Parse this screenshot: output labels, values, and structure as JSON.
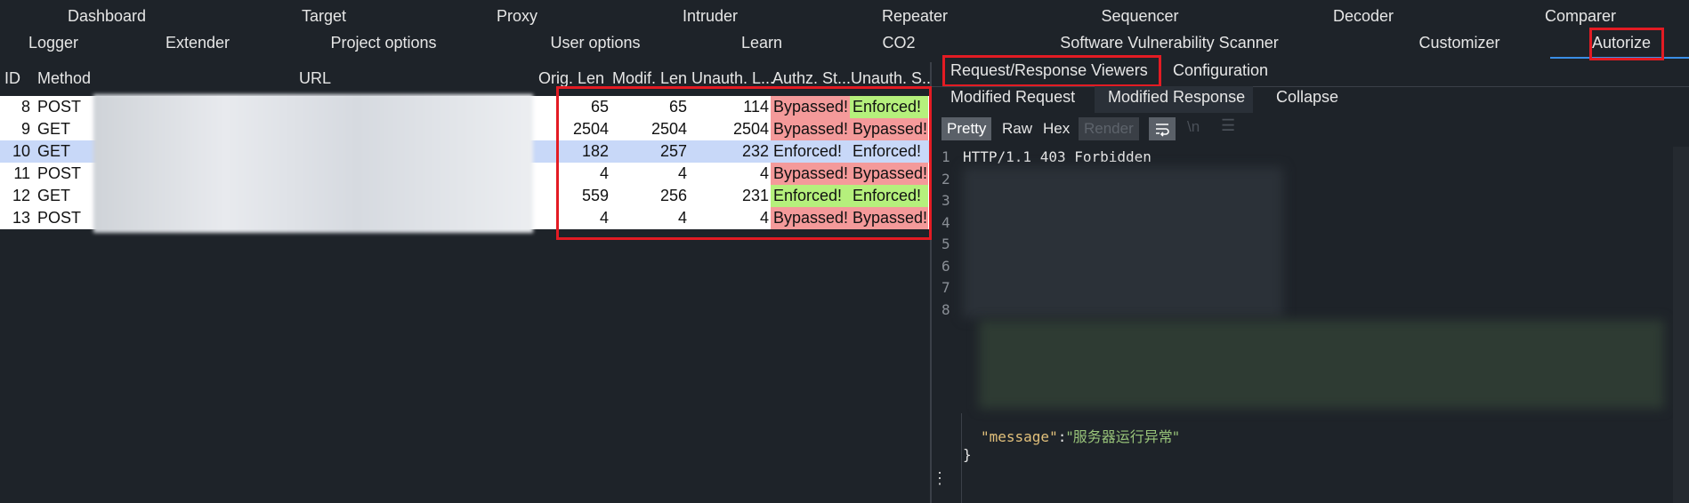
{
  "top_tabs_row1": [
    "Dashboard",
    "Target",
    "Proxy",
    "Intruder",
    "Repeater",
    "Sequencer",
    "Decoder",
    "Comparer"
  ],
  "top_tabs_row2": [
    "Logger",
    "Extender",
    "Project options",
    "User options",
    "Learn",
    "CO2",
    "Software Vulnerability Scanner",
    "Customizer",
    "Autorize"
  ],
  "table": {
    "headers": [
      "ID",
      "Method",
      "URL",
      "Orig. Len",
      "Modif. Len",
      "Unauth. L...",
      "Authz. St...",
      "Unauth. S..."
    ],
    "rows": [
      {
        "id": "8",
        "method": "POST",
        "orig": "65",
        "modif": "65",
        "unauth": "114",
        "authz": "Bypassed!",
        "unauth_status": "Enforced!"
      },
      {
        "id": "9",
        "method": "GET",
        "orig": "2504",
        "modif": "2504",
        "unauth": "2504",
        "authz": "Bypassed!",
        "unauth_status": "Bypassed!"
      },
      {
        "id": "10",
        "method": "GET",
        "orig": "182",
        "modif": "257",
        "unauth": "232",
        "authz": "Enforced!",
        "unauth_status": "Enforced!"
      },
      {
        "id": "11",
        "method": "POST",
        "orig": "4",
        "modif": "4",
        "unauth": "4",
        "authz": "Bypassed!",
        "unauth_status": "Bypassed!"
      },
      {
        "id": "12",
        "method": "GET",
        "orig": "559",
        "modif": "256",
        "unauth": "231",
        "authz": "Enforced!",
        "unauth_status": "Enforced!"
      },
      {
        "id": "13",
        "method": "POST",
        "orig": "4",
        "modif": "4",
        "unauth": "4",
        "authz": "Bypassed!",
        "unauth_status": "Bypassed!"
      }
    ]
  },
  "right": {
    "tabs": [
      "Request/Response Viewers",
      "Configuration"
    ],
    "subtabs": [
      "Modified Request",
      "Modified Response",
      "Collapse"
    ],
    "view_buttons": [
      "Pretty",
      "Raw",
      "Hex",
      "Render"
    ],
    "wrap_icon": "wrap-lines-icon",
    "newline_icon": "newline-icon",
    "menu_icon": "menu-icon",
    "line_numbers": [
      "1",
      "2",
      "3",
      "4",
      "5",
      "6",
      "7",
      "8"
    ],
    "status_line": "HTTP/1.1 403 Forbidden",
    "json_key": "\"message\"",
    "json_colon": ":",
    "json_value": "\"服务器运行异常\"",
    "closing_brace": "}",
    "side_handle": "⋮"
  },
  "colors": {
    "bypassed": "#f49a9a",
    "enforced": "#b5f07c",
    "selected_row": "#c8d8f8",
    "highlight_border": "#e31b23",
    "accent": "#3a8ee6",
    "json_key": "#e2c07b",
    "json_value": "#98c379"
  }
}
